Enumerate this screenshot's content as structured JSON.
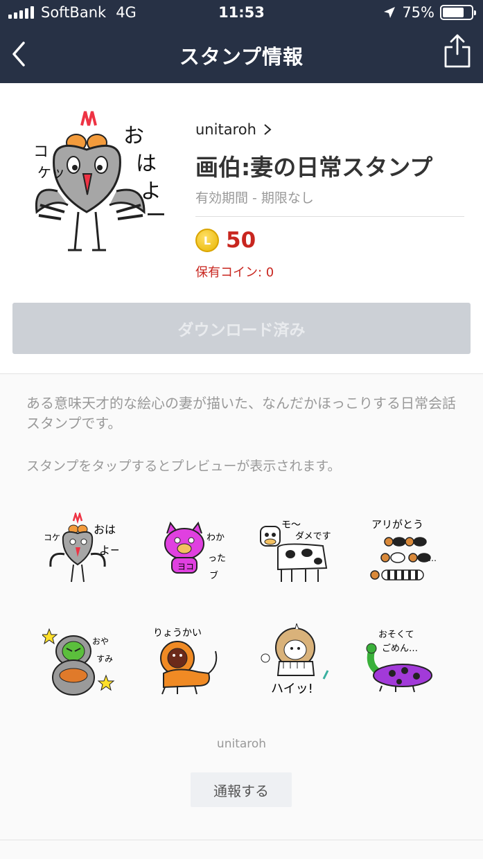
{
  "status_bar": {
    "carrier": "SoftBank",
    "network": "4G",
    "time": "11:53",
    "battery": "75%",
    "battery_level": 0.75
  },
  "nav": {
    "title": "スタンプ情報",
    "back_icon": "chevron-left-icon",
    "share_icon": "share-icon"
  },
  "package": {
    "author": "unitaroh",
    "title": "画伯:妻の日常スタンプ",
    "validity": "有効期間 - 期限なし",
    "coin_symbol": "L",
    "price": "50",
    "coins_owned": "保有コイン: 0",
    "download_label": "ダウンロード済み"
  },
  "description": "ある意味天才的な絵心の妻が描いた、なんだかほっこりする日常会話スタンプです。",
  "preview_hint": "スタンプをタップするとプレビューが表示されます。",
  "stickers": [
    {
      "text": "おはよー コケッ",
      "icon": "rooster-sticker"
    },
    {
      "text": "わかったブ",
      "icon": "pink-cat-sticker"
    },
    {
      "text": "モ〜ダメです",
      "icon": "cow-sticker"
    },
    {
      "text": "アリがとう",
      "icon": "ants-sticker"
    },
    {
      "text": "おやすみ",
      "icon": "owl-sticker"
    },
    {
      "text": "りょうかい",
      "icon": "lion-sticker"
    },
    {
      "text": "ハイッ!",
      "icon": "sheep-sticker"
    },
    {
      "text": "おそくてごめん…",
      "icon": "caterpillar-sticker"
    }
  ],
  "footer": {
    "author": "unitaroh",
    "report_label": "通報する"
  },
  "colors": {
    "nav_bg": "#273145",
    "price_red": "#c8261f",
    "button_disabled": "#ccd0d6"
  }
}
